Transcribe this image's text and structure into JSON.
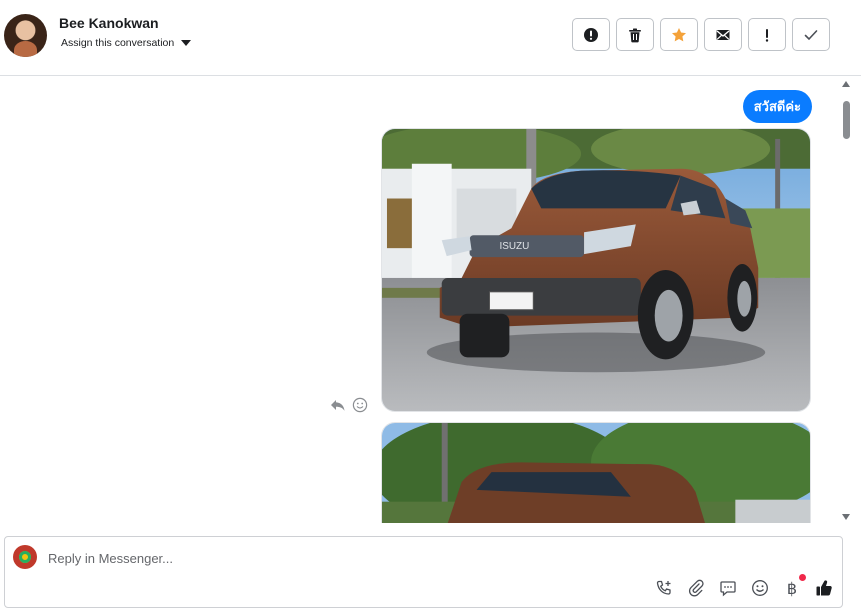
{
  "header": {
    "contact_name": "Bee Kanokwan",
    "assign_label": "Assign this conversation"
  },
  "toolbar": {
    "buttons": [
      {
        "name": "spam",
        "icon": "exclamation-circle-icon"
      },
      {
        "name": "delete",
        "icon": "trash-icon"
      },
      {
        "name": "star",
        "icon": "star-icon",
        "color": "#f4a23a"
      },
      {
        "name": "mark-unread",
        "icon": "envelope-icon"
      },
      {
        "name": "follow-up",
        "icon": "exclamation-icon"
      },
      {
        "name": "mark-done",
        "icon": "check-icon"
      }
    ]
  },
  "conversation": {
    "greeting": "สวัสดีค่ะ",
    "bubble_color": "#0a7cff"
  },
  "composer": {
    "placeholder": "Reply in Messenger...",
    "tools": [
      "phone-plus-icon",
      "paperclip-icon",
      "chat-bubble-icon",
      "emoji-icon",
      "baht-icon",
      "thumbs-up-icon"
    ],
    "baht_symbol": "฿"
  }
}
